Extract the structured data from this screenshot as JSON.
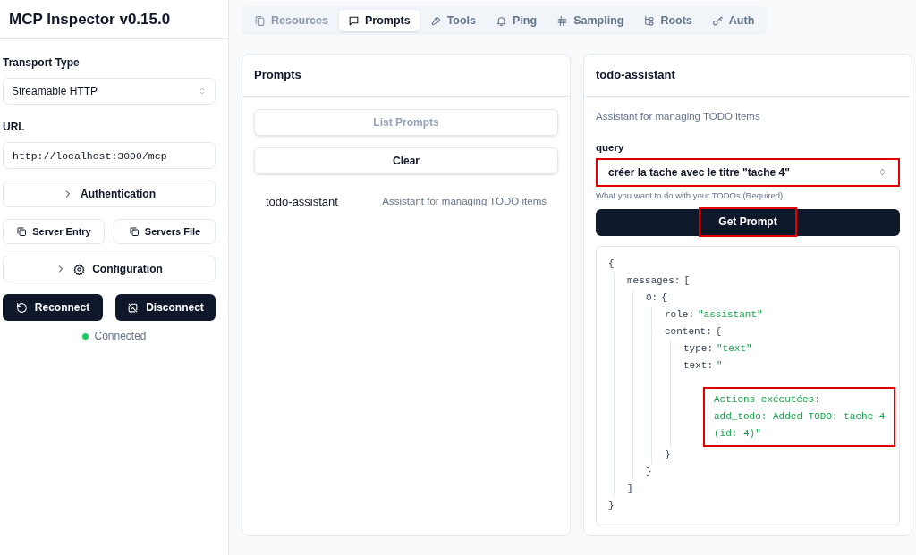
{
  "sidebar": {
    "title": "MCP Inspector v0.15.0",
    "transport": {
      "label": "Transport Type",
      "value": "Streamable HTTP"
    },
    "url": {
      "label": "URL",
      "value": "http://localhost:3000/mcp"
    },
    "authentication": {
      "label": "Authentication",
      "expanded": false
    },
    "copy_buttons": [
      "Server Entry",
      "Servers File"
    ],
    "configuration": {
      "label": "Configuration",
      "expanded": false
    },
    "actions": [
      {
        "kind": "reconnect",
        "label": "Reconnect"
      },
      {
        "kind": "disconnect",
        "label": "Disconnect"
      }
    ],
    "status": {
      "label": "Connected",
      "color": "#22c55e"
    }
  },
  "tabs": [
    {
      "kind": "resources",
      "label": "Resources",
      "selected": false,
      "disabled": true
    },
    {
      "kind": "prompts",
      "label": "Prompts",
      "selected": true,
      "disabled": false
    },
    {
      "kind": "tools",
      "label": "Tools",
      "selected": false,
      "disabled": false
    },
    {
      "kind": "ping",
      "label": "Ping",
      "selected": false,
      "disabled": false
    },
    {
      "kind": "sampling",
      "label": "Sampling",
      "selected": false,
      "disabled": false
    },
    {
      "kind": "roots",
      "label": "Roots",
      "selected": false,
      "disabled": false
    },
    {
      "kind": "auth",
      "label": "Auth",
      "selected": false,
      "disabled": false
    }
  ],
  "prompts_panel": {
    "title": "Prompts",
    "buttons": [
      {
        "label": "List Prompts",
        "disabled": true
      },
      {
        "label": "Clear",
        "disabled": false
      }
    ],
    "items": [
      {
        "name": "todo-assistant",
        "description": "Assistant for managing TODO items"
      }
    ]
  },
  "detail_panel": {
    "title": "todo-assistant",
    "description": "Assistant for managing TODO items",
    "argument": {
      "label": "query",
      "value": "créer la tache avec le titre \"tache 4\"",
      "hint": "What you want to do with your TODOs (Required)",
      "highlighted": true
    },
    "submit": {
      "label": "Get Prompt",
      "highlighted": true
    },
    "result": {
      "open": "{",
      "close": "}",
      "children": [
        {
          "key": "messages:",
          "open": "[",
          "close": "]",
          "children": [
            {
              "key": "0:",
              "open": "{",
              "close": "}",
              "children": [
                {
                  "key": "role:",
                  "value": "\"assistant\""
                },
                {
                  "key": "content:",
                  "open": "{",
                  "close": "}",
                  "children": [
                    {
                      "key": "type:",
                      "value": "\"text\""
                    },
                    {
                      "key": "text:",
                      "value": "\"",
                      "continuation": [
                        "Actions exécutées:",
                        "add_todo: Added TODO: tache 4",
                        "(id: 4)\""
                      ],
                      "highlighted": true
                    }
                  ]
                }
              ]
            }
          ]
        }
      ]
    }
  }
}
